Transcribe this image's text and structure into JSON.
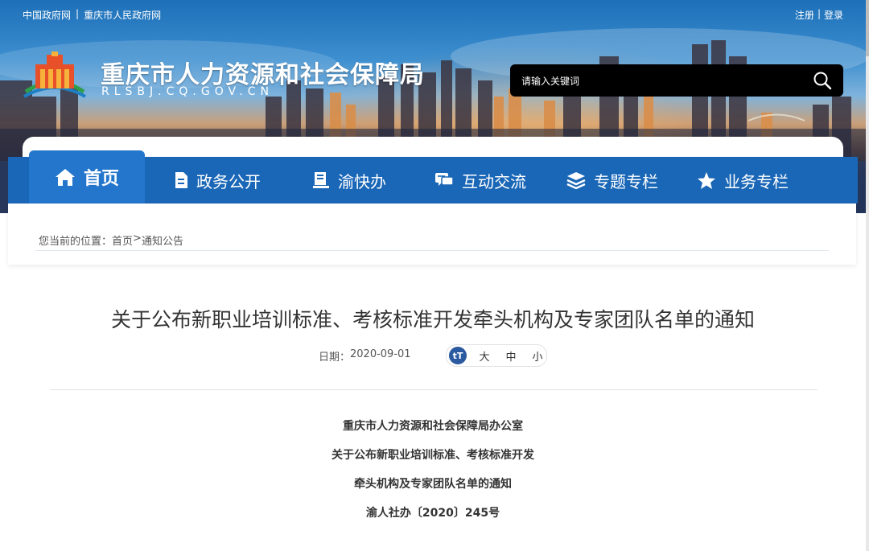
{
  "top_links": [
    "中国政府网",
    "重庆市人民政府网"
  ],
  "top_link_separator": "|",
  "account": {
    "register": "注册",
    "separator": "|",
    "login": "登录"
  },
  "site": {
    "title": "重庆市人力资源和社会保障局",
    "domain": "RLSBJ.CQ.GOV.CN"
  },
  "search": {
    "placeholder": "请输入关键词",
    "icon": "search-icon"
  },
  "nav": [
    {
      "label": "首页",
      "icon": "home-icon",
      "active": true
    },
    {
      "label": "政务公开",
      "icon": "document-icon"
    },
    {
      "label": "渝快办",
      "icon": "office-icon"
    },
    {
      "label": "互动交流",
      "icon": "chat-icon"
    },
    {
      "label": "专题专栏",
      "icon": "layers-icon"
    },
    {
      "label": "业务专栏",
      "icon": "star-icon"
    }
  ],
  "breadcrumb": {
    "prefix": "您当前的位置：",
    "items": [
      "首页",
      "通知公告"
    ],
    "separator": ">"
  },
  "article": {
    "title": "关于公布新职业培训标准、考核标准开发牵头机构及专家团队名单的通知",
    "date_label": "日期：",
    "date": "2020-09-01",
    "font_sizes": [
      "大",
      "中",
      "小"
    ],
    "body": [
      "重庆市人力资源和社会保障局办公室",
      "关于公布新职业培训标准、考核标准开发",
      "牵头机构及专家团队名单的通知",
      "渝人社办〔2020〕245号"
    ]
  },
  "colors": {
    "nav_bg": "#1a67b7",
    "nav_active": "#2376cc",
    "search_bg": "#000000"
  }
}
